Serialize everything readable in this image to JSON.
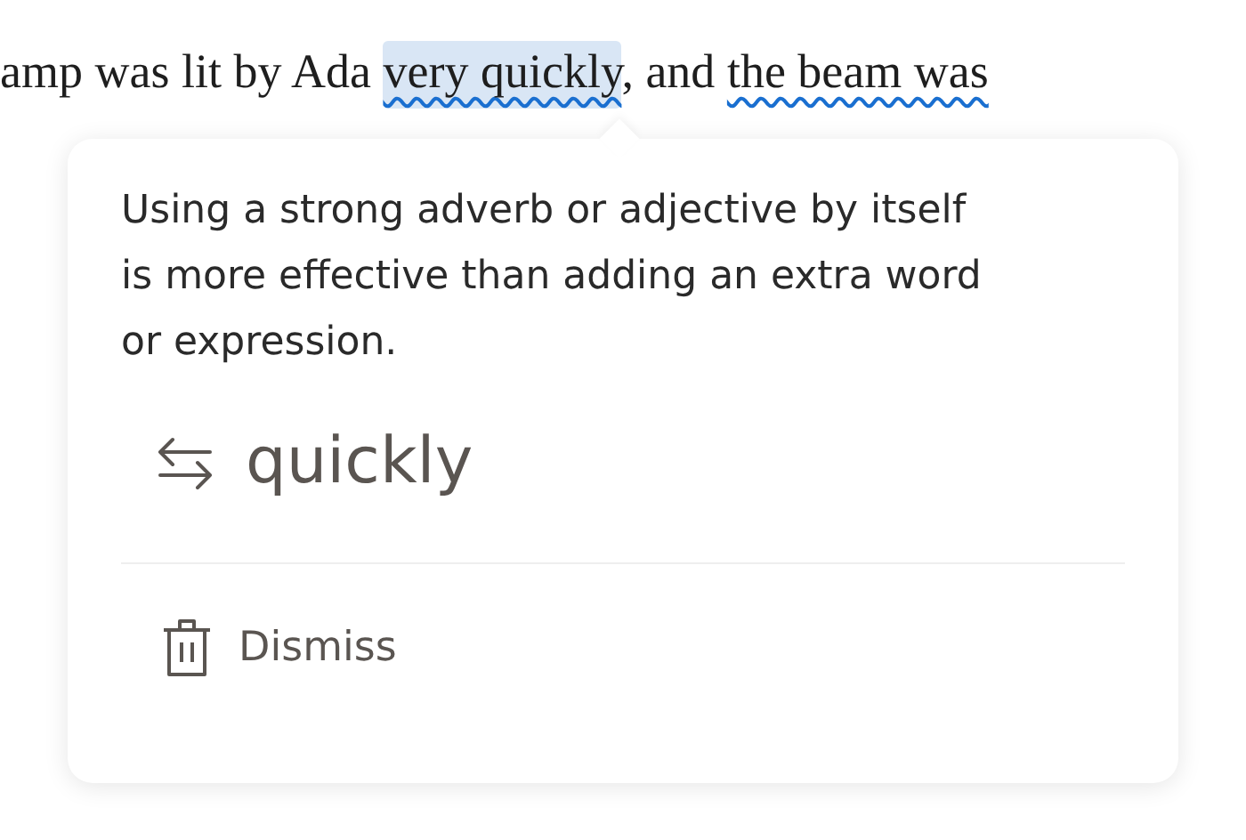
{
  "sentence": [
    {
      "text": "amp was lit by Ada ",
      "flagged": false,
      "selected": false
    },
    {
      "text": "very quickly",
      "flagged": true,
      "selected": true
    },
    {
      "text": ", and ",
      "flagged": false,
      "selected": false
    },
    {
      "text": "the beam was",
      "flagged": true,
      "selected": false
    }
  ],
  "suggestion_card": {
    "explanation": "Using a strong adverb or adjective by itself is more effective than adding an extra word or expression.",
    "replacement": "quickly",
    "dismiss": "Dismiss"
  }
}
